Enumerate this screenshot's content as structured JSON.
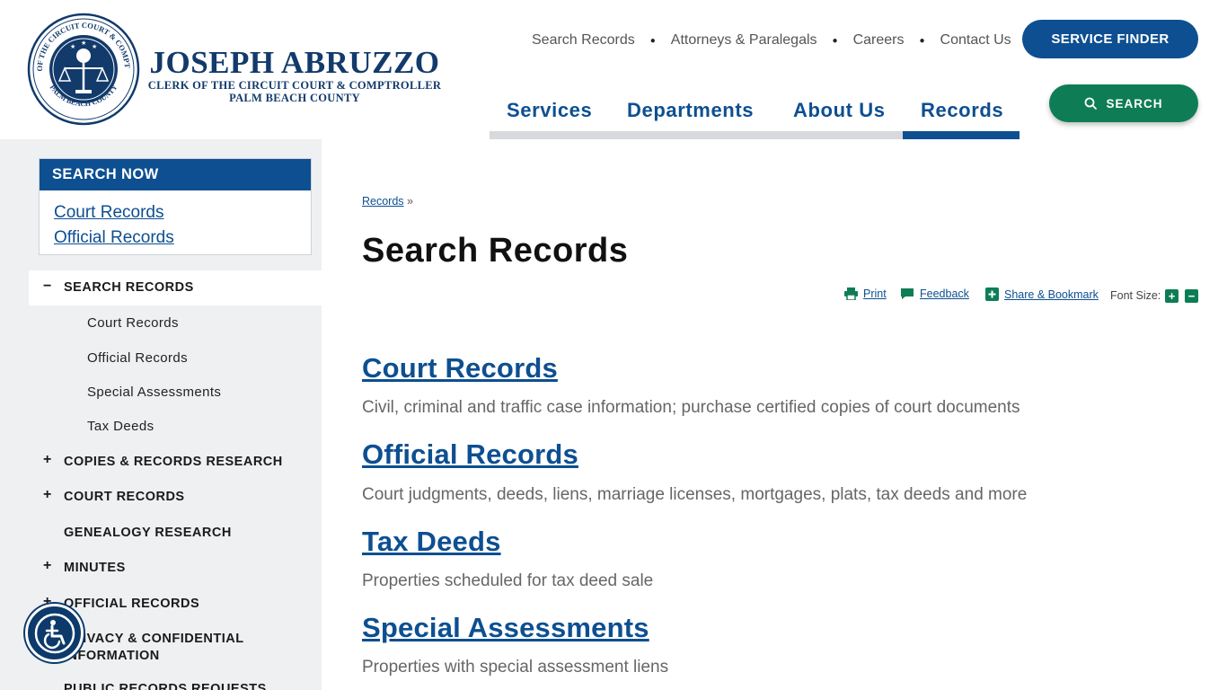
{
  "header": {
    "logo": {
      "name": "JOSEPH ABRUZZO",
      "line1": "CLERK OF THE CIRCUIT COURT & COMPTROLLER",
      "line2": "PALM BEACH COUNTY",
      "seal_top_text": "CLERK OF THE CIRCUIT COURT & COMPTROLLER",
      "seal_bottom_text": "PALM BEACH COUNTY"
    },
    "utility_nav": [
      "Search Records",
      "Attorneys & Paralegals",
      "Careers",
      "Contact Us"
    ],
    "service_finder_label": "SERVICE FINDER",
    "search_label": "SEARCH",
    "main_nav": [
      {
        "label": "Services",
        "active": false
      },
      {
        "label": "Departments",
        "active": false
      },
      {
        "label": "About Us",
        "active": false
      },
      {
        "label": "Records",
        "active": true
      }
    ]
  },
  "sidebar": {
    "search_now": {
      "title": "SEARCH NOW",
      "links": [
        "Court Records",
        "Official Records"
      ]
    },
    "items": [
      {
        "label": "SEARCH RECORDS",
        "sign": "−",
        "expanded": true
      },
      {
        "label": "Court Records"
      },
      {
        "label": "Official Records"
      },
      {
        "label": "Special Assessments"
      },
      {
        "label": "Tax Deeds"
      },
      {
        "label": "COPIES & RECORDS RESEARCH",
        "sign": "+"
      },
      {
        "label": "COURT RECORDS",
        "sign": "+"
      },
      {
        "label": "GENEALOGY RESEARCH",
        "sign": ""
      },
      {
        "label": "MINUTES",
        "sign": "+"
      },
      {
        "label": "OFFICIAL RECORDS",
        "sign": "+"
      },
      {
        "label": "PRIVACY & CONFIDENTIAL",
        "label2": "INFORMATION",
        "sign": ""
      },
      {
        "label": "PUBLIC RECORDS REQUESTS",
        "sign": ""
      }
    ]
  },
  "content": {
    "breadcrumb": {
      "link": "Records",
      "sep": "»"
    },
    "title": "Search Records",
    "tools": {
      "print": "Print",
      "feedback": "Feedback",
      "share": "Share & Bookmark",
      "font_size": "Font Size:",
      "increase": "+",
      "decrease": "−"
    },
    "entries": [
      {
        "title": "Court Records",
        "desc": "Civil, criminal and traffic case information; purchase certified copies of court documents"
      },
      {
        "title": "Official Records",
        "desc": "Court judgments, deeds, liens, marriage licenses, mortgages, plats, tax deeds and more"
      },
      {
        "title": "Tax Deeds",
        "desc": "Properties scheduled for tax deed sale"
      },
      {
        "title": "Special Assessments",
        "desc": "Properties with special assessment liens"
      }
    ]
  },
  "colors": {
    "brand_blue": "#0d4f91",
    "brand_green": "#0e7d55",
    "sidebar_bg": "#eef0f2"
  }
}
